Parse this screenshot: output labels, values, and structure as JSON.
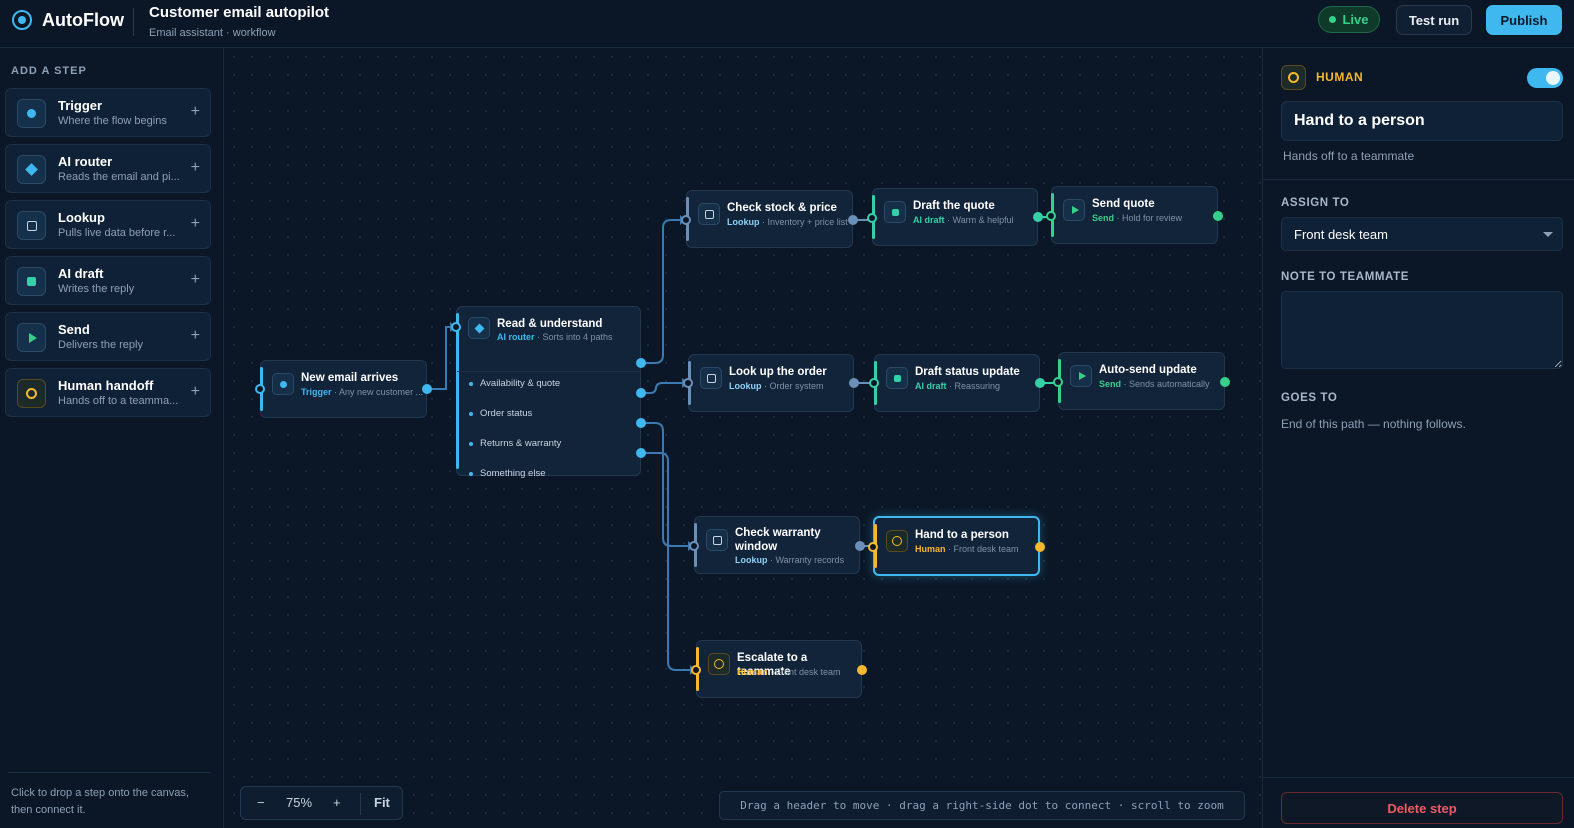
{
  "app": {
    "name": "AutoFlow",
    "workflow_title": "Customer email autopilot",
    "workflow_subtitle": "Email assistant · workflow",
    "status": "Live",
    "test_run_label": "Test run",
    "publish_label": "Publish"
  },
  "palette": {
    "title": "ADD A STEP",
    "items": [
      {
        "name": "Trigger",
        "desc": "Where the flow begins",
        "icon": "trigger-dot-icon"
      },
      {
        "name": "AI router",
        "desc": "Reads the email and pi...",
        "icon": "router-diamond-icon"
      },
      {
        "name": "Lookup",
        "desc": "Pulls live data before r...",
        "icon": "lookup-square-icon"
      },
      {
        "name": "AI draft",
        "desc": "Writes the reply",
        "icon": "draft-square-icon"
      },
      {
        "name": "Send",
        "desc": "Delivers the reply",
        "icon": "send-play-icon"
      },
      {
        "name": "Human handoff",
        "desc": "Hands off to a teamma...",
        "icon": "human-ring-icon"
      }
    ],
    "add_symbol": "+",
    "help": "Click to drop a step onto the canvas, then connect it."
  },
  "nodes": {
    "new_email": {
      "title": "New email arrives",
      "kind": "Trigger",
      "detail": "Any new customer ..."
    },
    "read": {
      "title": "Read & understand",
      "kind": "AI router",
      "detail": "Sorts into 4 paths",
      "routes": [
        "Availability & quote",
        "Order status",
        "Returns & warranty",
        "Something else"
      ]
    },
    "check_stock": {
      "title": "Check stock & price",
      "kind": "Lookup",
      "detail": "Inventory + price list"
    },
    "draft_quote": {
      "title": "Draft the quote",
      "kind": "AI draft",
      "detail": "Warm & helpful"
    },
    "send_quote": {
      "title": "Send quote",
      "kind": "Send",
      "detail": "Hold for review"
    },
    "lookup_order": {
      "title": "Look up the order",
      "kind": "Lookup",
      "detail": "Order system"
    },
    "draft_status": {
      "title": "Draft status update",
      "kind": "AI draft",
      "detail": "Reassuring"
    },
    "auto_send": {
      "title": "Auto-send update",
      "kind": "Send",
      "detail": "Sends automatically"
    },
    "check_warranty": {
      "title": "Check warranty window",
      "kind": "Lookup",
      "detail": "Warranty records"
    },
    "hand_person": {
      "title": "Hand to a person",
      "kind": "Human",
      "detail": "Front desk team"
    },
    "escalate": {
      "title": "Escalate to a teammate",
      "kind": "Human",
      "detail": "Front desk team"
    }
  },
  "sep": " · ",
  "zoom": {
    "minus": "−",
    "level": "75%",
    "plus": "+",
    "fit": "Fit"
  },
  "hint": "Drag a header to move · drag a right-side dot to connect · scroll to zoom",
  "inspector": {
    "kind": "HUMAN",
    "enabled": true,
    "name": "Hand to a person",
    "description": "Hands off to a teammate",
    "assign_label": "ASSIGN TO",
    "assign_value": "Front desk team",
    "note_label": "NOTE TO TEAMMATE",
    "note_value": "",
    "goes_label": "GOES TO",
    "goes_value": "End of this path — nothing follows.",
    "delete_label": "Delete step"
  },
  "colors": {
    "accent": "#3fb8f0",
    "draft": "#35d0a8",
    "send": "#35d08a",
    "human": "#f5b82e",
    "danger": "#f05a64",
    "background": "#0b1726"
  }
}
